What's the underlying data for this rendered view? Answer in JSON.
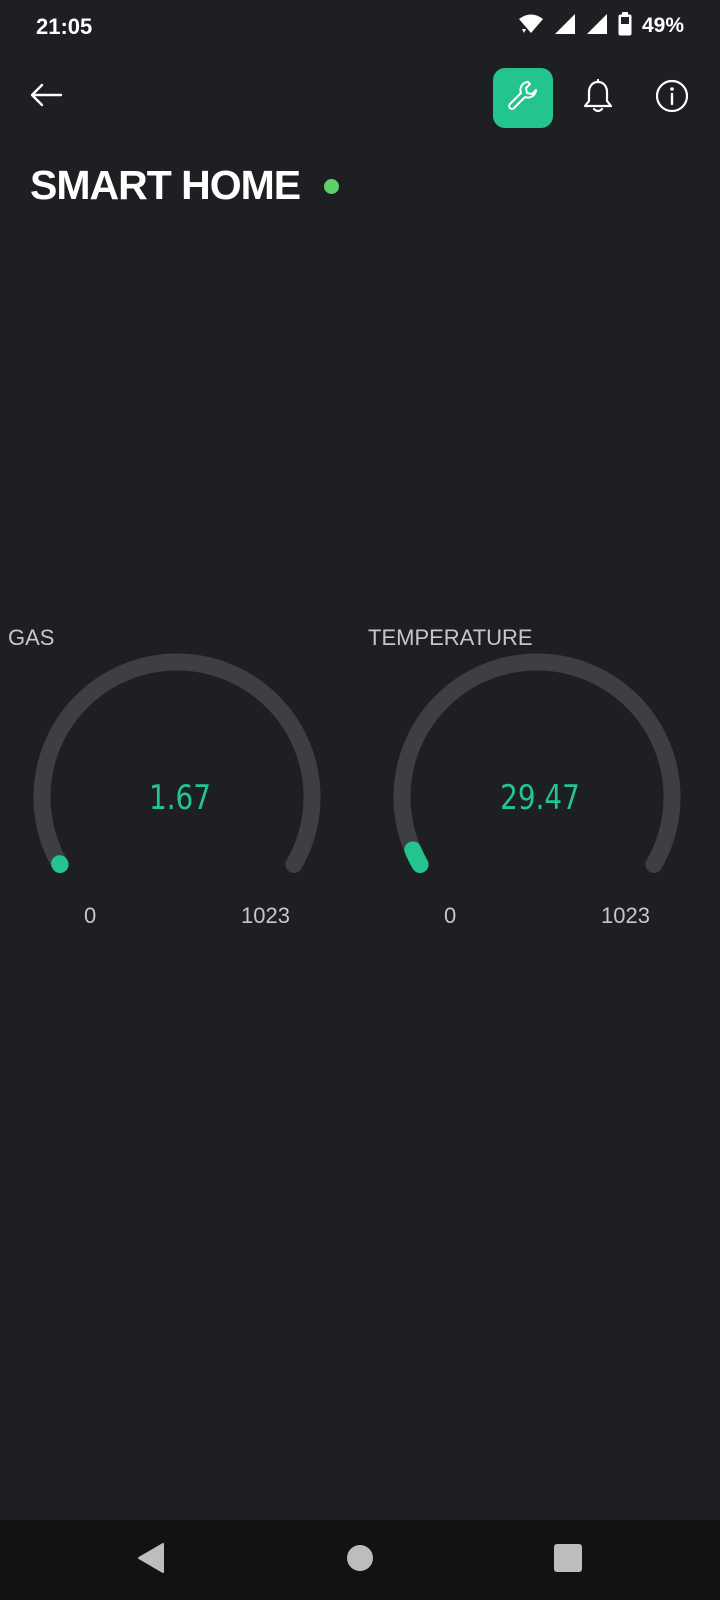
{
  "status_bar": {
    "time": "21:05",
    "battery_percent": "49%",
    "icons": [
      "wifi-icon",
      "cell-signal-icon",
      "cell-signal-icon",
      "battery-icon"
    ]
  },
  "toolbar": {
    "back_icon": "arrow-left-icon",
    "actions": [
      "wrench-icon",
      "bell-icon",
      "info-icon"
    ],
    "accent_color": "#23c48e"
  },
  "header": {
    "title": "SMART HOME",
    "status_color": "#5fd068"
  },
  "widgets": [
    {
      "label": "GAS",
      "value": "1.67",
      "value_numeric": 1.67,
      "min": "0",
      "max": "1023",
      "min_numeric": 0,
      "max_numeric": 1023
    },
    {
      "label": "TEMPERATURE",
      "value": "29.47",
      "value_numeric": 29.47,
      "min": "0",
      "max": "1023",
      "min_numeric": 0,
      "max_numeric": 1023
    }
  ],
  "colors": {
    "background": "#1e1f23",
    "gauge_track": "#3e3f44",
    "gauge_fill": "#23c48e",
    "label_text": "#c6c7cb"
  },
  "nav_bar": {
    "buttons": [
      "nav-back-icon",
      "nav-home-icon",
      "nav-recents-icon"
    ]
  }
}
